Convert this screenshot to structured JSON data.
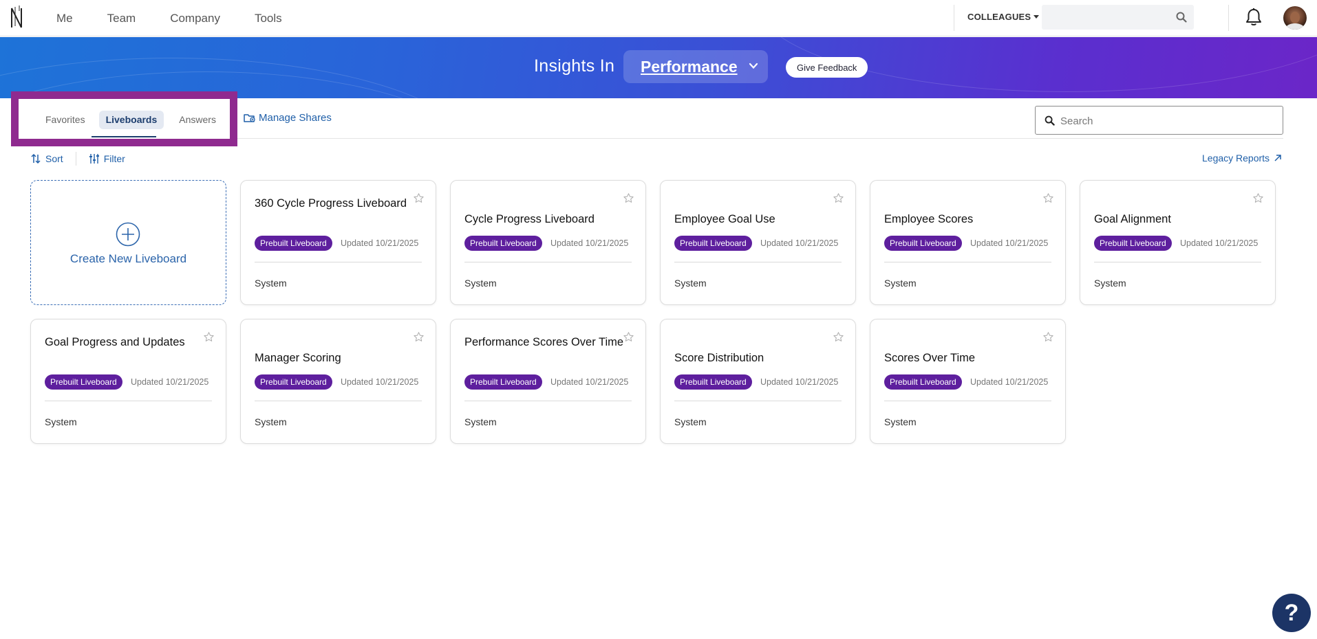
{
  "nav": {
    "links": [
      "Me",
      "Team",
      "Company",
      "Tools"
    ],
    "colleagues_label": "COLLEAGUES",
    "search_placeholder": ""
  },
  "banner": {
    "title": "Insights In",
    "selected_module": "Performance",
    "feedback_label": "Give Feedback"
  },
  "tabs": {
    "favorites": "Favorites",
    "liveboards": "Liveboards",
    "answers": "Answers",
    "active": "Liveboards",
    "highlight_color": "#8f2a8f"
  },
  "manage_shares_label": "Manage Shares",
  "search": {
    "placeholder": "Search"
  },
  "toolbar": {
    "sort_label": "Sort",
    "filter_label": "Filter",
    "legacy_label": "Legacy Reports"
  },
  "create_card": {
    "label": "Create New Liveboard"
  },
  "cards": [
    {
      "title": "360 Cycle Progress Liveboard",
      "badge": "Prebuilt Liveboard",
      "updated": "Updated 10/21/2025",
      "owner": "System"
    },
    {
      "title": "Cycle Progress Liveboard",
      "badge": "Prebuilt Liveboard",
      "updated": "Updated 10/21/2025",
      "owner": "System"
    },
    {
      "title": "Employee Goal Use",
      "badge": "Prebuilt Liveboard",
      "updated": "Updated 10/21/2025",
      "owner": "System"
    },
    {
      "title": "Employee Scores",
      "badge": "Prebuilt Liveboard",
      "updated": "Updated 10/21/2025",
      "owner": "System"
    },
    {
      "title": "Goal Alignment",
      "badge": "Prebuilt Liveboard",
      "updated": "Updated 10/21/2025",
      "owner": "System"
    },
    {
      "title": "Goal Progress and Updates",
      "badge": "Prebuilt Liveboard",
      "updated": "Updated 10/21/2025",
      "owner": "System"
    },
    {
      "title": "Manager Scoring",
      "badge": "Prebuilt Liveboard",
      "updated": "Updated 10/21/2025",
      "owner": "System"
    },
    {
      "title": "Performance Scores Over Time",
      "badge": "Prebuilt Liveboard",
      "updated": "Updated 10/21/2025",
      "owner": "System"
    },
    {
      "title": "Score Distribution",
      "badge": "Prebuilt Liveboard",
      "updated": "Updated 10/21/2025",
      "owner": "System"
    },
    {
      "title": "Scores Over Time",
      "badge": "Prebuilt Liveboard",
      "updated": "Updated 10/21/2025",
      "owner": "System"
    }
  ],
  "help_label": "?",
  "colors": {
    "badge": "#5e1f9e",
    "link": "#1f5fa8",
    "banner_start": "#1e73d8",
    "banner_end": "#6b26c8"
  }
}
